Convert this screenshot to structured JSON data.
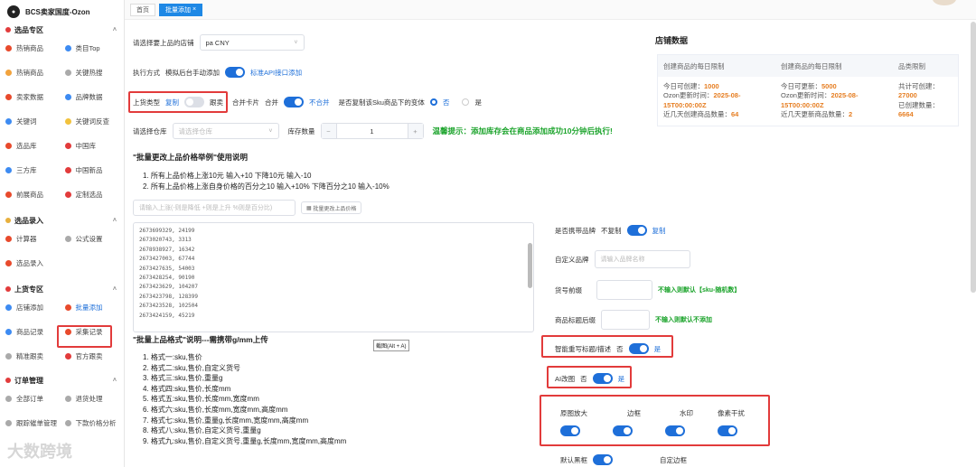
{
  "app": {
    "title": "BCS卖家国度-Ozon"
  },
  "sidebar": {
    "sections": [
      {
        "title": "选品专区",
        "items": [
          "热销商品",
          "类目Top",
          "热销商品",
          "关键热搜",
          "卖家数据",
          "品牌数据",
          "关键词",
          "关键词反查",
          "选品库",
          "中国库",
          "三方库",
          "中国新品",
          "前展商品",
          "定制选品"
        ]
      },
      {
        "title": "选品录入",
        "items": [
          "计算器",
          "公式设置",
          "选品录入"
        ]
      },
      {
        "title": "上货专区",
        "items": [
          "店铺添加",
          "批量添加",
          "商品记录",
          "采集记录",
          "精准跟卖",
          "官方跟卖"
        ]
      },
      {
        "title": "订单管理",
        "items": [
          "全部订单",
          "退货处理",
          "跟踪催单管理",
          "下款价格分析"
        ]
      }
    ]
  },
  "tabs": [
    "首页",
    "批量添加"
  ],
  "form": {
    "store_label": "请选择要上品的店铺",
    "store_value": "pa CNY",
    "exec_label": "执行方式",
    "exec_manual": "模拟后台手动添加",
    "exec_api": "标准API接口添加",
    "type_label": "上货类型",
    "type_copy": "复制",
    "type_follow": "跟卖",
    "merge_label": "合并卡片",
    "merge_on": "合并",
    "merge_off": "不合并",
    "variant_label": "是否复制该Sku商品下的变体",
    "variant_no": "否",
    "variant_yes": "是",
    "warehouse_label": "请选择仓库",
    "warehouse_placeholder": "请选择仓库",
    "stock_label": "库存数量",
    "stock_value": "1",
    "stepper_minus": "−",
    "stepper_plus": "+",
    "warm_tip": "温馨提示：添加库存会在商品添加成功10分钟后执行!"
  },
  "price": {
    "title": "\"批量更改上品价格举例\"使用说明",
    "lines": [
      "1. 所有上品价格上涨10元 输入+10 下降10元 输入-10",
      "2. 所有上品价格上涨自身价格的百分之10 输入+10% 下降百分之10 输入-10%"
    ],
    "input_placeholder": "请输入上涨(-则是降低 +则是上升 %则是百分比)",
    "button": "批量更改上品价格"
  },
  "skus": [
    "2673699329, 24199",
    "2673020743, 3313",
    "2678938927, 16342",
    "2673427003, 67744",
    "2673427635, 54003",
    "2673428254, 90190",
    "2673423629, 104207",
    "2673423798, 128399",
    "2673423528, 102504",
    "2673424159, 45219"
  ],
  "format": {
    "title": "\"批量上品格式\"说明---需携带g/mm上传",
    "lines": [
      "1. 格式一:sku,售价",
      "2. 格式二:sku,售价,自定义货号",
      "3. 格式三:sku,售价,重量g",
      "4. 格式四:sku,售价,长度mm",
      "5. 格式五:sku,售价,长度mm,宽度mm",
      "6. 格式六:sku,售价,长度mm,宽度mm,高度mm",
      "7. 格式七:sku,售价,重量g,长度mm,宽度mm,高度mm",
      "8. 格式八:sku,售价,自定义货号,重量g",
      "9. 格式九:sku,售价,自定义货号,重量g,长度mm,宽度mm,高度mm"
    ],
    "tooltip": "截图(Alt + A)"
  },
  "right": {
    "brand_label": "是否携带品牌",
    "brand_no": "不复制",
    "brand_yes": "复制",
    "custom_brand_label": "自定义品牌",
    "custom_brand_placeholder": "请输入品牌名称",
    "prefix_label": "货号前缀",
    "prefix_hint": "不输入则默认【sku-随机数】",
    "suffix_label": "商品标题后缀",
    "suffix_hint": "不输入则默认不添加",
    "rewrite_label": "智能重写标题/描述",
    "rewrite_no": "否",
    "rewrite_yes": "是",
    "ai_label": "AI改图",
    "ai_no": "否",
    "ai_yes": "是",
    "opts": [
      "原图放大",
      "边框",
      "水印",
      "像素干扰"
    ],
    "bottom": [
      "默认黑框",
      "自定边框"
    ]
  },
  "store": {
    "title": "店铺数据",
    "headers": [
      "创建商品的每日限制",
      "创建商品的每日限制",
      "品类限制"
    ],
    "col1": {
      "a": "今日可创建：",
      "av": "1000",
      "b": "Ozon更新时间：",
      "bv": "2025-08-15T00:00:00Z",
      "c": "近几天创建商品数量：",
      "cv": "64"
    },
    "col2": {
      "a": "今日可更新：",
      "av": "5000",
      "b": "Ozon更新时间：",
      "bv": "2025-08-15T00:00:00Z",
      "c": "近几天更新商品数量：",
      "cv": "2"
    },
    "col3": {
      "a": "共计可创建：",
      "av": "27000",
      "b": "已创建数量：",
      "bv": "6664"
    }
  },
  "watermark": "大数跨境"
}
